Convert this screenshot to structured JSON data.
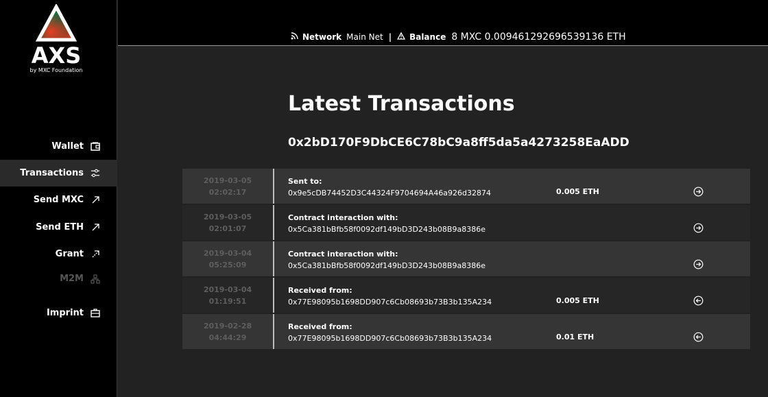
{
  "brand": {
    "name": "AXS",
    "subtitle": "by MXC Foundation"
  },
  "sidebar": {
    "items": [
      {
        "label": "Wallet",
        "icon": "wallet-icon"
      },
      {
        "label": "Transactions",
        "icon": "sliders-icon",
        "active": true
      },
      {
        "label": "Send MXC",
        "icon": "send-arrow-icon"
      },
      {
        "label": "Send ETH",
        "icon": "send-arrow-icon"
      },
      {
        "label": "Grant",
        "icon": "grant-arrow-icon"
      },
      {
        "label": "M2M",
        "icon": "network-icon",
        "disabled": true
      },
      {
        "label": "Imprint",
        "icon": "briefcase-icon"
      }
    ]
  },
  "status": {
    "network_label": "Network",
    "network_value": "Main Net",
    "separator": "|",
    "balance_label": "Balance",
    "balance_value": "8 MXC 0.009461292696539136 ETH"
  },
  "main": {
    "title": "Latest Transactions",
    "address": "0x2bD170F9DbCE6C78bC9a8ff5da5a4273258EaADD"
  },
  "transactions": [
    {
      "date": "2019-03-05",
      "time": "02:02:17",
      "kind": "Sent to:",
      "address": "0x9e5cDB74452D3C44324F9704694A46a926d32874",
      "amount": "0.005 ETH",
      "direction": "out"
    },
    {
      "date": "2019-03-05",
      "time": "02:01:07",
      "kind": "Contract interaction with:",
      "address": "0x5Ca381bBfb58f0092df149bD3D243b08B9a8386e",
      "amount": "",
      "direction": "out"
    },
    {
      "date": "2019-03-04",
      "time": "05:25:09",
      "kind": "Contract interaction with:",
      "address": "0x5Ca381bBfb58f0092df149bD3D243b08B9a8386e",
      "amount": "",
      "direction": "out"
    },
    {
      "date": "2019-03-04",
      "time": "01:19:51",
      "kind": "Received from:",
      "address": "0x77E98095b1698DD907c6Cb08693b73B3b135A234",
      "amount": "0.005 ETH",
      "direction": "in"
    },
    {
      "date": "2019-02-28",
      "time": "04:44:29",
      "kind": "Received from:",
      "address": "0x77E98095b1698DD907c6Cb08693b73B3b135A234",
      "amount": "0.01 ETH",
      "direction": "in"
    }
  ],
  "colors": {
    "sidebar_bg": "#000000",
    "main_bg": "#222222",
    "row_odd": "#353535",
    "row_even": "#262626",
    "date_text": "#5e5e5e"
  }
}
